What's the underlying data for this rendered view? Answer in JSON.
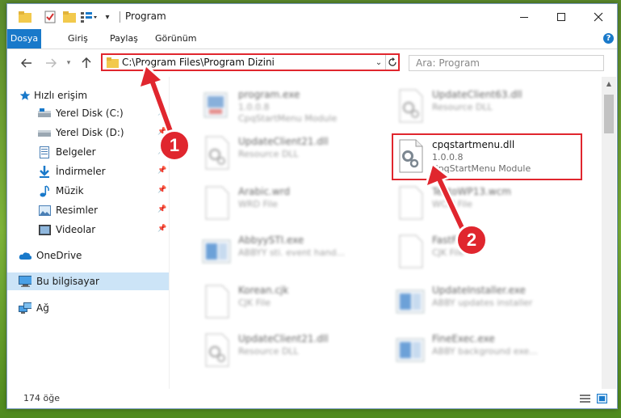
{
  "window": {
    "title": "Program"
  },
  "ribbon": {
    "tabs": [
      "Dosya",
      "Giriş",
      "Paylaş",
      "Görünüm"
    ]
  },
  "address": {
    "path": "C:\\Program Files\\Program Dizini"
  },
  "search": {
    "placeholder": "Ara: Program"
  },
  "sidebar": {
    "items": [
      {
        "label": "Hızlı erişim",
        "icon": "star-icon",
        "pinned": false
      },
      {
        "label": "Yerel Disk (C:)",
        "icon": "drive-icon",
        "pinned": true
      },
      {
        "label": "Yerel Disk (D:)",
        "icon": "drive-icon",
        "pinned": true
      },
      {
        "label": "Belgeler",
        "icon": "documents-icon",
        "pinned": true
      },
      {
        "label": "İndirmeler",
        "icon": "download-icon",
        "pinned": true
      },
      {
        "label": "Müzik",
        "icon": "music-icon",
        "pinned": true
      },
      {
        "label": "Resimler",
        "icon": "pictures-icon",
        "pinned": true
      },
      {
        "label": "Videolar",
        "icon": "video-icon",
        "pinned": true
      },
      {
        "label": "OneDrive",
        "icon": "cloud-icon",
        "pinned": false
      },
      {
        "label": "Bu bilgisayar",
        "icon": "computer-icon",
        "pinned": false,
        "selected": true
      },
      {
        "label": "Ağ",
        "icon": "network-icon",
        "pinned": false
      }
    ]
  },
  "files": [
    {
      "name": "program.exe",
      "line2": "1.0.0.8",
      "line3": "CpqStartMenu Module",
      "icon": "app-icon",
      "blurred": true
    },
    {
      "name": "UpdateClient63.dll",
      "line2": "Resource DLL",
      "line3": "",
      "icon": "dll-icon",
      "blurred": true
    },
    {
      "name": "UpdateClient21.dll",
      "line2": "Resource DLL",
      "line3": "",
      "icon": "dll-icon",
      "blurred": true
    },
    {
      "name": "cpqstartmenu.dll",
      "line2": "1.0.0.8",
      "line3": "CpqStartMenu Module",
      "icon": "dll-icon",
      "blurred": false
    },
    {
      "name": "Arabic.wrd",
      "line2": "WRD File",
      "line3": "",
      "icon": "file-icon",
      "blurred": true
    },
    {
      "name": "TextoWP13.wcm",
      "line2": "WCM File",
      "line3": "",
      "icon": "file-icon",
      "blurred": true
    },
    {
      "name": "AbbyySTI.exe",
      "line2": "ABBYY sti. event hand...",
      "line3": "",
      "icon": "app-icon",
      "blurred": true
    },
    {
      "name": "FastFix.cjk",
      "line2": "CJK File",
      "line3": "",
      "icon": "file-icon",
      "blurred": true
    },
    {
      "name": "Korean.cjk",
      "line2": "CJK File",
      "line3": "",
      "icon": "file-icon",
      "blurred": true
    },
    {
      "name": "UpdateInstaller.exe",
      "line2": "ABBY updates installer",
      "line3": "",
      "icon": "app-icon",
      "blurred": true
    },
    {
      "name": "UpdateClient21.dll",
      "line2": "Resource DLL",
      "line3": "",
      "icon": "dll-icon",
      "blurred": true
    },
    {
      "name": "FineExec.exe",
      "line2": "ABBY background exe...",
      "line3": "",
      "icon": "app-icon",
      "blurred": true
    }
  ],
  "status": {
    "item_count": "174 öğe"
  },
  "annotations": {
    "step1": "1",
    "step2": "2",
    "color": "#e0262e"
  },
  "colors": {
    "accent": "#1979ca",
    "selection": "#cce4f7",
    "highlight": "#e0262e"
  }
}
